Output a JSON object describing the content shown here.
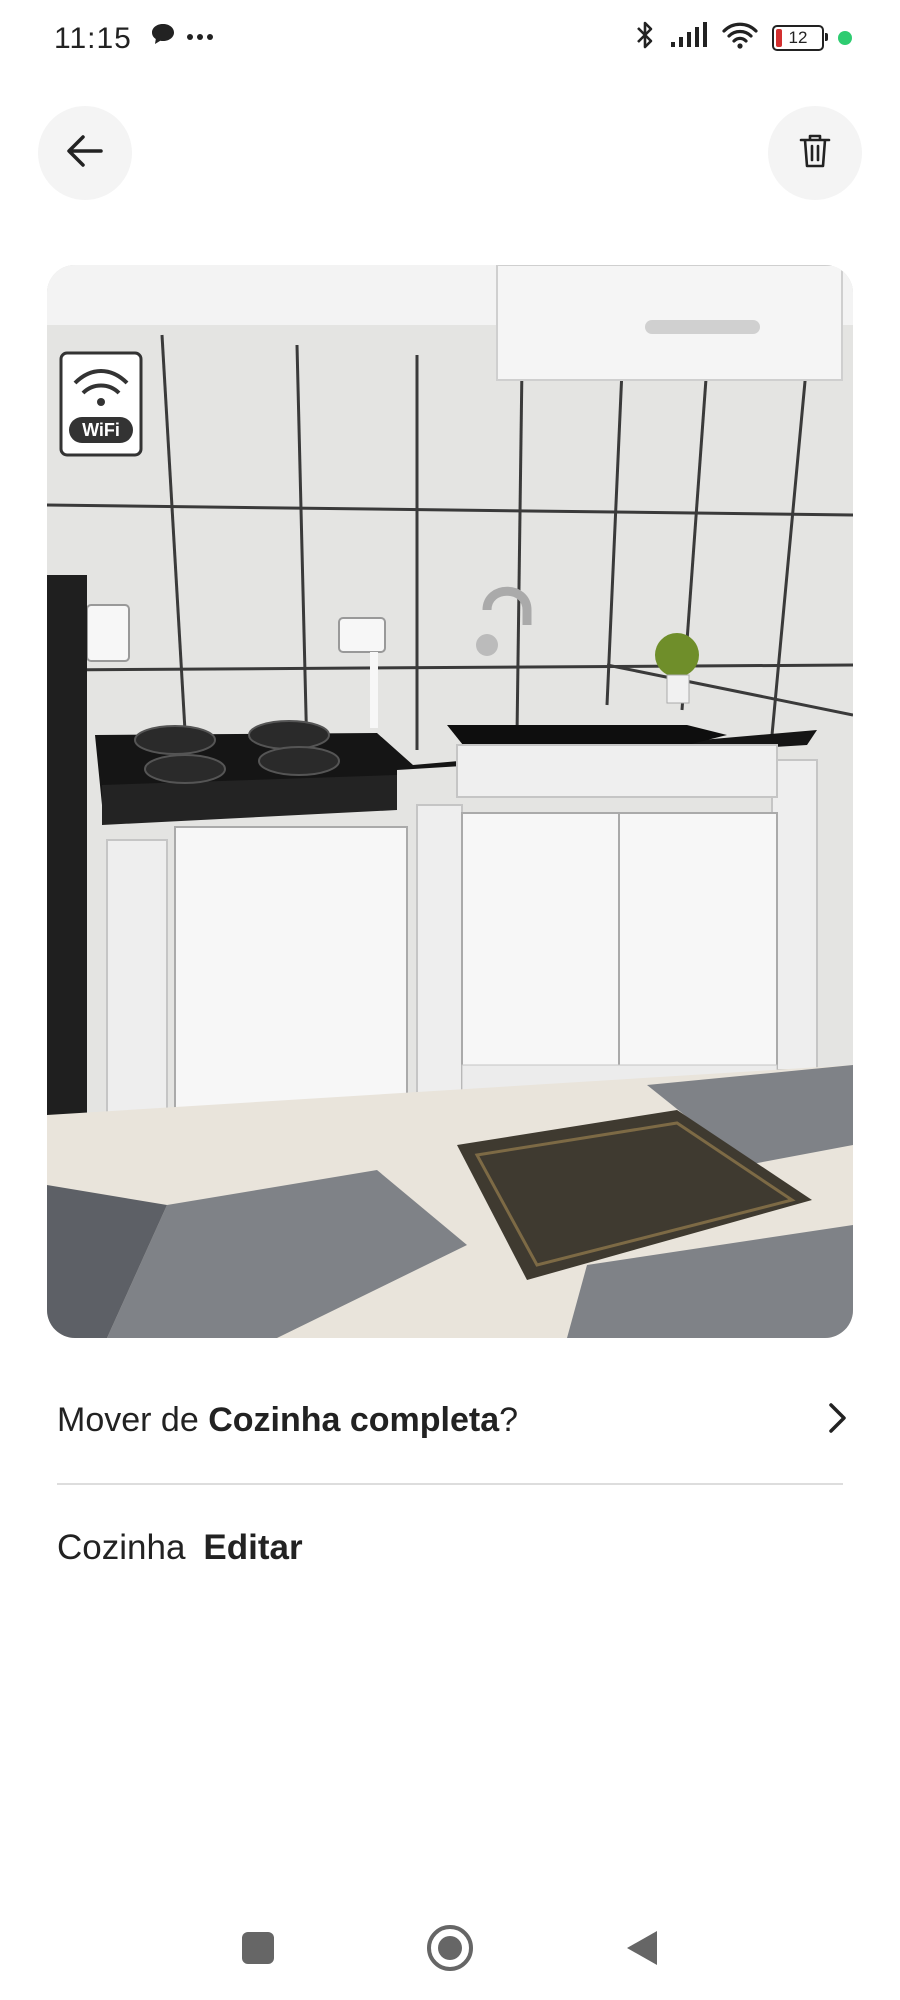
{
  "status_bar": {
    "time": "11:15",
    "battery_level": "12",
    "icons": [
      "chat-bubble-icon",
      "more-dots-icon",
      "bluetooth-icon",
      "signal-icon",
      "wifi-icon",
      "battery-icon",
      "privacy-dot-icon"
    ]
  },
  "header": {
    "back_icon": "arrow-left-icon",
    "delete_icon": "trash-icon"
  },
  "photo": {
    "sign_text": "WiFi"
  },
  "move_row": {
    "prefix": "Mover de ",
    "room": "Cozinha completa",
    "suffix": "?",
    "icon": "chevron-right-icon"
  },
  "room_row": {
    "name": "Cozinha",
    "edit_label": "Editar"
  },
  "nav": {
    "icons": [
      "recents-icon",
      "home-icon",
      "back-icon"
    ]
  },
  "colors": {
    "privacy_dot": "#2ecc71",
    "battery_low": "#d32f2f",
    "button_bg": "#f4f4f4"
  }
}
